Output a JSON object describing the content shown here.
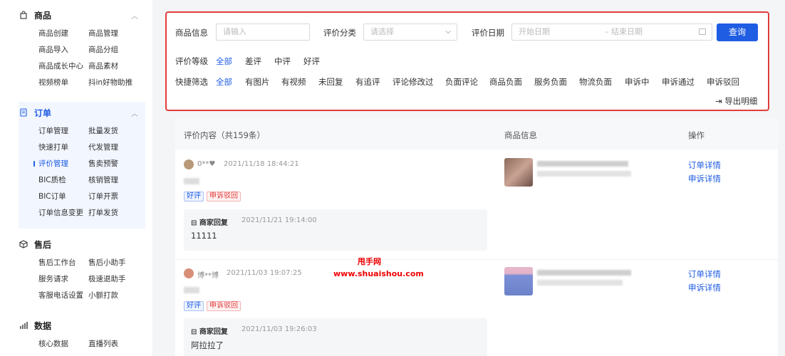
{
  "sidebar": {
    "groups": [
      {
        "title": "商品",
        "icon": "bag-icon",
        "items": [
          "商品创建",
          "商品管理",
          "商品导入",
          "商品分组",
          "商品成长中心",
          "商品素材",
          "视频榜单",
          "抖in好物助推"
        ]
      },
      {
        "title": "订单",
        "icon": "document-icon",
        "items": [
          "订单管理",
          "批量发货",
          "快速打单",
          "代发管理",
          "评价管理",
          "售卖预警",
          "BIC质检",
          "核销管理",
          "BIC订单",
          "订单开票",
          "订单信息变更",
          "打单发货"
        ],
        "selected": "评价管理"
      },
      {
        "title": "售后",
        "icon": "box-icon",
        "items": [
          "售后工作台",
          "售后小助手",
          "服务请求",
          "极速退助手",
          "客服电话设置",
          "小额打款"
        ]
      },
      {
        "title": "数据",
        "icon": "chart-icon",
        "items": [
          "核心数据",
          "直播列表"
        ]
      }
    ]
  },
  "filter": {
    "product_label": "商品信息",
    "product_placeholder": "请输入",
    "category_label": "评价分类",
    "category_placeholder": "请选择",
    "date_label": "评价日期",
    "date_start_placeholder": "开始日期",
    "date_end_placeholder": "– 结束日期",
    "query_label": "查询",
    "level_label": "评价等级",
    "levels": [
      "全部",
      "差评",
      "中评",
      "好评"
    ],
    "quick_label": "快捷筛选",
    "quick": [
      "全部",
      "有图片",
      "有视频",
      "未回复",
      "有追评",
      "评论修改过",
      "负面评论",
      "商品负面",
      "服务负面",
      "物流负面",
      "申诉中",
      "申诉通过",
      "申诉驳回"
    ],
    "export_label": "导出明细"
  },
  "table": {
    "col_content": "评价内容（共159条）",
    "col_product": "商品信息",
    "col_action": "操作",
    "rows": [
      {
        "user": "0**♥",
        "time": "2021/11/18 18:44:21",
        "tag_good": "好评",
        "tag_appeal": "申诉驳回",
        "reply_title": "商家回复",
        "reply_time": "2021/11/21 19:14:00",
        "reply_text": "11111",
        "link1": "订单详情",
        "link2": "申诉详情"
      },
      {
        "user": "博**博",
        "time": "2021/11/03 19:07:25",
        "tag_good": "好评",
        "tag_appeal": "申诉驳回",
        "reply_title": "商家回复",
        "reply_time": "2021/11/03 19:26:03",
        "reply_text": "阿拉拉了",
        "link1": "订单详情",
        "link2": "申诉详情"
      }
    ]
  },
  "watermark": {
    "line1": "甩手网",
    "line2": "www.shuaishou.com"
  },
  "colors": {
    "accent": "#1f5de3",
    "highlight_border": "#e23c3c"
  }
}
